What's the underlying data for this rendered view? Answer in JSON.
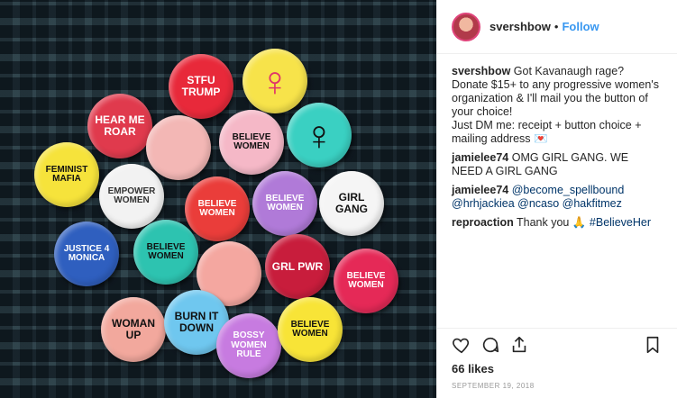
{
  "post": {
    "username": "svershbow",
    "follow_label": "Follow",
    "dot": "•",
    "likes": "66 likes",
    "date": "SEPTEMBER 19, 2018"
  },
  "photo": {
    "buttons": [
      {
        "text": "FEMINIST MAFIA",
        "color": "#f6e33b",
        "fg": "#111"
      },
      {
        "text": "HEAR ME ROAR",
        "color": "#e03a4d",
        "fg": "#fff"
      },
      {
        "text": "STFU TRUMP",
        "color": "#e8293a",
        "fg": "#fff"
      },
      {
        "text": "♀",
        "color": "#f7e34a",
        "fg": "#e0336a"
      },
      {
        "text": "",
        "color": "#f3b7b5",
        "fg": "#111"
      },
      {
        "text": "BELIEVE WOMEN",
        "color": "#f5b8c7",
        "fg": "#111"
      },
      {
        "text": "♀",
        "color": "#3ad0c2",
        "fg": "#111"
      },
      {
        "text": "EMPOWER WOMEN",
        "color": "#f2f2f2",
        "fg": "#333"
      },
      {
        "text": "BELIEVE WOMEN",
        "color": "#ea3d3a",
        "fg": "#fff"
      },
      {
        "text": "BELIEVE WOMEN",
        "color": "#b07ad8",
        "fg": "#fff"
      },
      {
        "text": "GIRL GANG",
        "color": "#f5f5f5",
        "fg": "#111"
      },
      {
        "text": "JUSTICE 4 MONICA",
        "color": "#2f5fbf",
        "fg": "#fff"
      },
      {
        "text": "BELIEVE WOMEN",
        "color": "#2dc3b0",
        "fg": "#111"
      },
      {
        "text": "",
        "color": "#f4a7a0",
        "fg": "#111"
      },
      {
        "text": "GRL PWR",
        "color": "#c81d3c",
        "fg": "#fff"
      },
      {
        "text": "BELIEVE WOMEN",
        "color": "#e52957",
        "fg": "#fff"
      },
      {
        "text": "WOMAN UP",
        "color": "#f2a89d",
        "fg": "#111"
      },
      {
        "text": "BURN IT DOWN",
        "color": "#6fc7ef",
        "fg": "#111"
      },
      {
        "text": "BOSSY WOMEN RULE",
        "color": "#c77be0",
        "fg": "#fff"
      },
      {
        "text": "BELIEVE WOMEN",
        "color": "#f8e437",
        "fg": "#111"
      }
    ]
  },
  "comments": [
    {
      "user": "svershbow",
      "text": "Got Kavanaugh rage? Donate $15+ to any progressive women's organization & I'll mail you the button of your choice!",
      "text2": "Just DM me: receipt + button choice + mailing address 💌"
    },
    {
      "user": "jamielee74",
      "text": "OMG GIRL GANG. WE NEED A GIRL GANG"
    },
    {
      "user": "jamielee74",
      "mentions": "@become_spellbound @hrhjackiea @ncaso @hakfitmez"
    },
    {
      "user": "reproaction",
      "text": "Thank you 🙏",
      "hashtag": "#BelieveHer"
    }
  ]
}
